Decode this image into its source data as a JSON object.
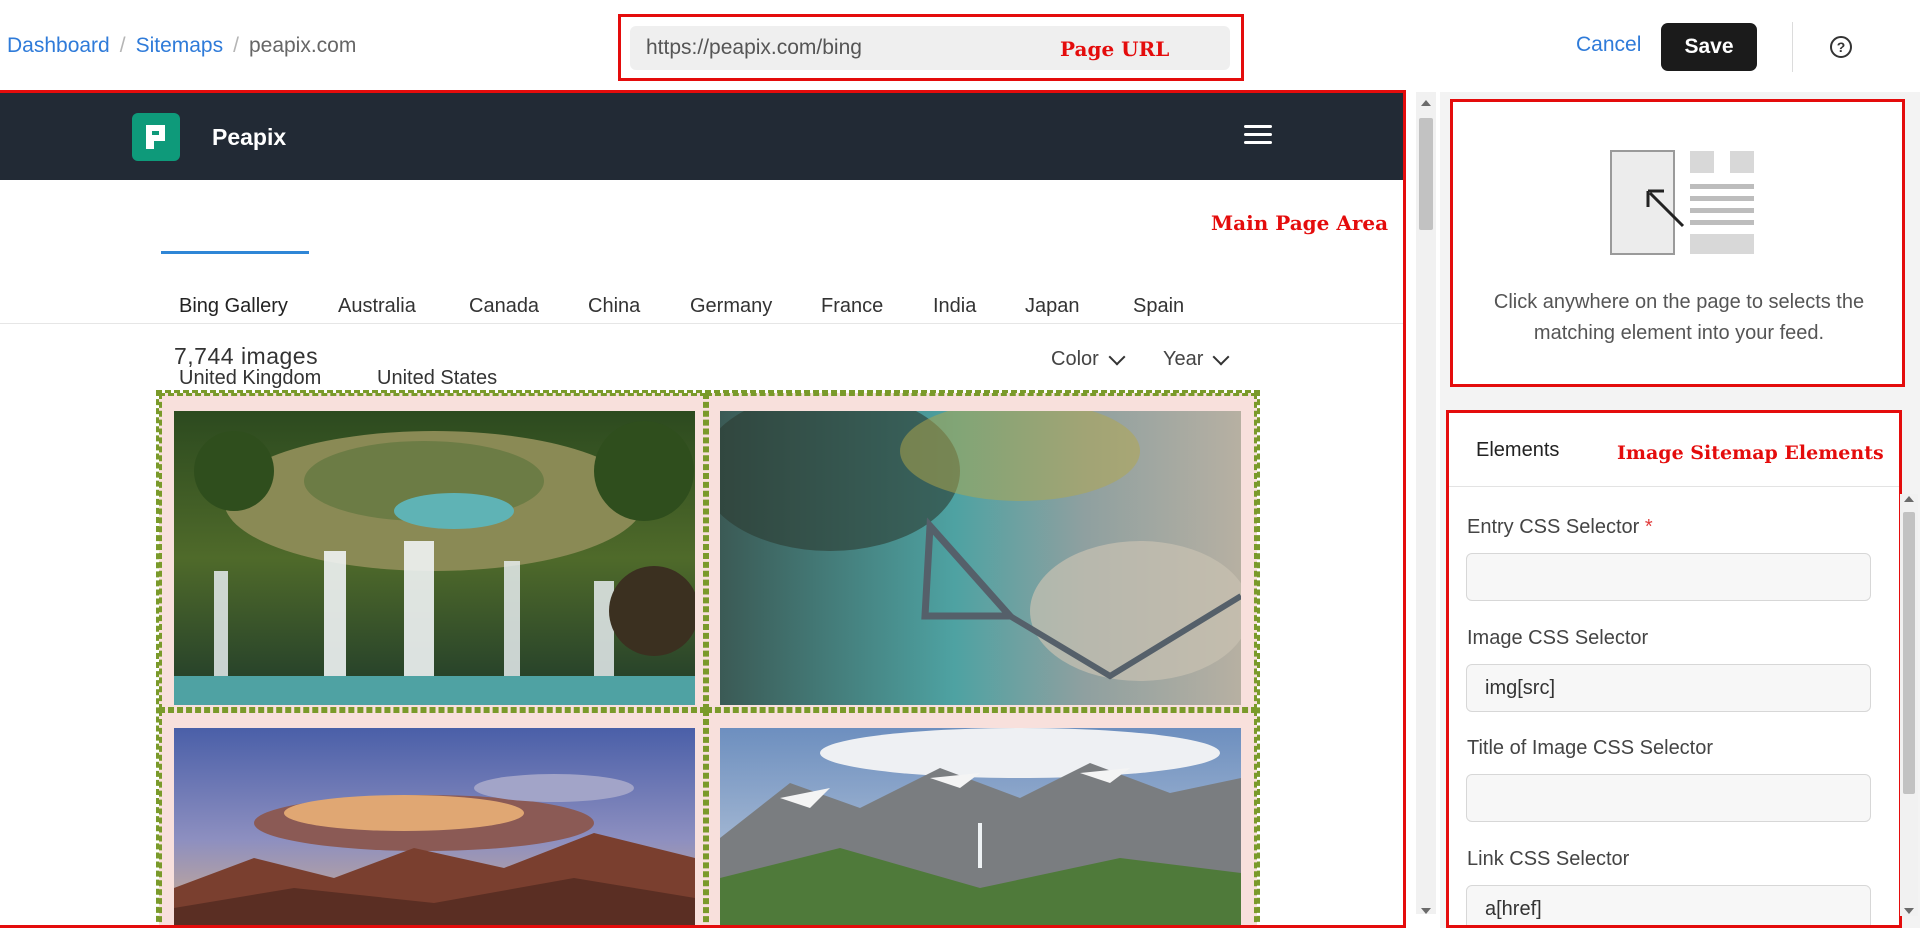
{
  "breadcrumb": {
    "items": [
      "Dashboard",
      "Sitemaps"
    ],
    "separator": "/",
    "current": "peapix.com"
  },
  "url_bar": {
    "value": "https://peapix.com/bing",
    "annotation": "Page URL"
  },
  "header_actions": {
    "cancel_label": "Cancel",
    "save_label": "Save",
    "help_icon": "question-circle-icon",
    "help_glyph": "?"
  },
  "site": {
    "name": "Peapix",
    "logo_icon": "peapix-logo",
    "menu_icon": "hamburger-icon",
    "nav_color": "#222a35",
    "logo_color": "#0e9a7a"
  },
  "main_annotation": "Main Page Area",
  "country_tabs": [
    "Bing Gallery",
    "Australia",
    "Canada",
    "China",
    "Germany",
    "France",
    "India",
    "Japan",
    "Spain",
    "United Kingdom",
    "United States"
  ],
  "active_tab": "Bing Gallery",
  "gallery": {
    "count_text": "7,744 images",
    "filters": [
      "Color",
      "Year"
    ],
    "photos": [
      "waterfall-aerial-photo",
      "lagoon-aerial-photo",
      "sunset-mountains-photo",
      "alpine-valley-photo"
    ]
  },
  "right_panel": {
    "hint_text": "Click anywhere on the page to selects the matching element into your feed.",
    "hint_icon": "select-element-illustration",
    "elements_tab": "Elements",
    "elements_annotation": "Image Sitemap Elements",
    "fields": [
      {
        "label": "Entry CSS Selector",
        "required_mark": "*",
        "value": ""
      },
      {
        "label": "Image CSS Selector",
        "value": "img[src]"
      },
      {
        "label": "Title of Image CSS Selector",
        "value": ""
      },
      {
        "label": "Link CSS Selector",
        "value": "a[href]"
      }
    ]
  },
  "colors": {
    "annotation_red": "#e40c0c",
    "link_blue": "#2f7bd9",
    "selection_green": "#7a9a2a",
    "selection_fill": "#f8e0dc"
  }
}
